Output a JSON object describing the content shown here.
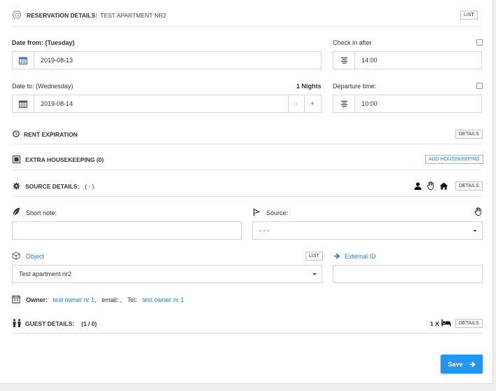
{
  "reservation": {
    "title": "RESERVATION DETAILS:",
    "name": "TEST APARTMENT NR2",
    "list_label": "LIST"
  },
  "dates": {
    "from_label_prefix": "Date from:",
    "from_label_day": "(Tuesday)",
    "from_value": "2019-08-13",
    "to_label": "Date to: (Wednesday)",
    "nights": "1 Nights",
    "to_value": "2019-08-14",
    "minus": "-",
    "plus": "+"
  },
  "checkin": {
    "label": "Check in after",
    "value": "14:00",
    "checked": false
  },
  "departure": {
    "label": "Departure time:",
    "value": "10:00",
    "checked": false
  },
  "rent_expiration": {
    "title": "RENT EXPIRATION",
    "details_label": "DETAILS"
  },
  "housekeeping": {
    "title": "EXTRA HOUSEKEEPING (0)",
    "add_label": "ADD HOUSEKEEPING"
  },
  "source_details": {
    "title": "SOURCE DETAILS:",
    "value": "( - )",
    "details_label": "DETAILS"
  },
  "short_note": {
    "label": "Short note:",
    "value": ""
  },
  "source": {
    "label": "Source:",
    "value": "- - -"
  },
  "object": {
    "label": "Object",
    "list_label": "LIST",
    "value": "Test apartment nr2"
  },
  "external_id": {
    "label": "External ID",
    "value": ""
  },
  "owner": {
    "label": "Owner:",
    "name": "test owner nr 1",
    "sep1": ",",
    "email_label": "email:",
    "email_value": ",",
    "tel_label": "Tel:",
    "tel_value": "test owner nr 1"
  },
  "guest": {
    "title": "GUEST DETAILS:",
    "count": "(1 / 0)",
    "beds": "1 X",
    "details_label": "DETAILS"
  },
  "save_label": "Save",
  "colors": {
    "accent": "#2196f3",
    "link": "#2d7fcf",
    "calendar_icon": "#3b6fd6"
  }
}
